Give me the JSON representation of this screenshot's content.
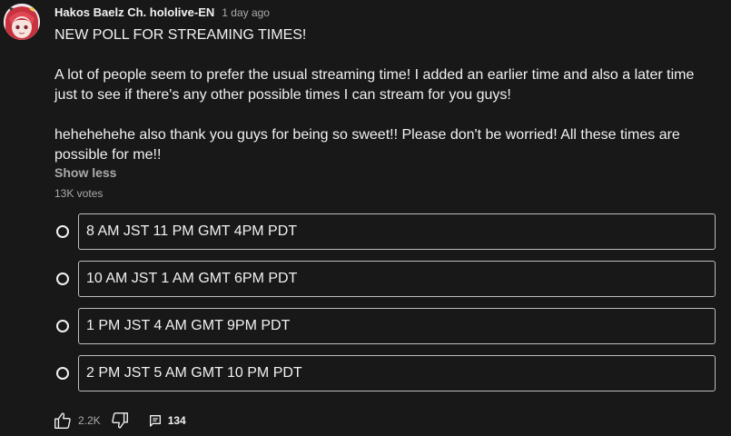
{
  "post": {
    "author": "Hakos Baelz Ch. hololive-EN",
    "time": "1 day ago",
    "title": "NEW POLL FOR STREAMING TIMES!",
    "paragraph1": "A lot of people seem to prefer the usual streaming time! I added an earlier time and also a later time just to see if there's any other possible times I can stream for you guys!",
    "paragraph2": "hehehehehe also thank you guys for being so sweet!! Please don't be worried! All these times are possible for me!!",
    "show_less": "Show less",
    "votes": "13K votes"
  },
  "poll": {
    "options": [
      {
        "label": "8 AM JST 11 PM GMT 4PM PDT"
      },
      {
        "label": "10 AM JST 1 AM GMT 6PM PDT"
      },
      {
        "label": "1 PM JST 4 AM GMT 9PM PDT"
      },
      {
        "label": "2 PM JST 5 AM GMT 10 PM PDT"
      }
    ]
  },
  "actions": {
    "like_count": "2.2K",
    "comment_count": "134",
    "like_icon": "thumbs-up-icon",
    "dislike_icon": "thumbs-down-icon",
    "comment_icon": "comment-icon"
  },
  "colors": {
    "background": "#181818",
    "text_primary": "#f1f1f1",
    "text_secondary": "#aaaaaa",
    "option_border": "#bdbdbd"
  }
}
